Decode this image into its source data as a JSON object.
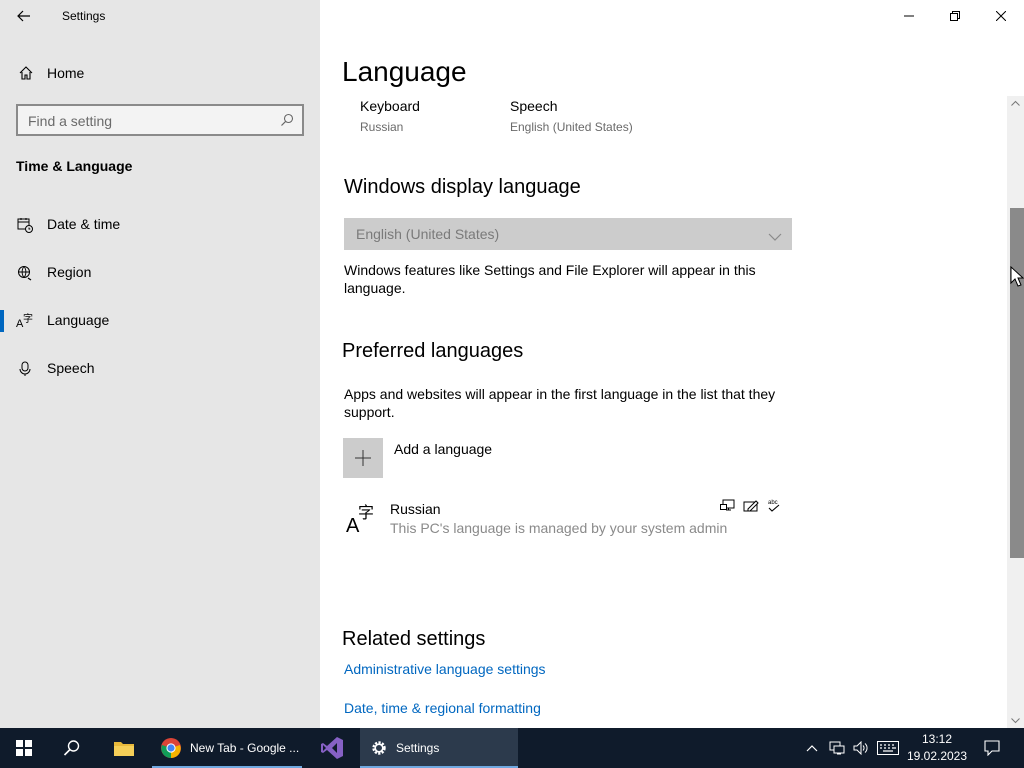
{
  "window": {
    "title": "Settings"
  },
  "sidebar": {
    "home_label": "Home",
    "search_placeholder": "Find a setting",
    "section_heading": "Time & Language",
    "items": [
      {
        "label": "Date & time",
        "icon": "date-time-icon",
        "active": false
      },
      {
        "label": "Region",
        "icon": "region-icon",
        "active": false
      },
      {
        "label": "Language",
        "icon": "language-icon",
        "active": true
      },
      {
        "label": "Speech",
        "icon": "microphone-icon",
        "active": false
      }
    ]
  },
  "main": {
    "page_title": "Language",
    "summary": {
      "keyboard_label": "Keyboard",
      "keyboard_value": "Russian",
      "speech_label": "Speech",
      "speech_value": "English (United States)"
    },
    "display_language": {
      "heading": "Windows display language",
      "selected": "English (United States)",
      "description": "Windows features like Settings and File Explorer will appear in this language."
    },
    "preferred": {
      "heading": "Preferred languages",
      "description": "Apps and websites will appear in the first language in the list that they support.",
      "add_label": "Add a language",
      "languages": [
        {
          "name": "Russian",
          "note": "This PC's language is managed by your system admin",
          "features": [
            "display-language-icon",
            "handwriting-icon",
            "spellcheck-icon"
          ]
        }
      ]
    },
    "related": {
      "heading": "Related settings",
      "links": [
        "Administrative language settings",
        "Date, time & regional formatting"
      ]
    }
  },
  "taskbar": {
    "apps": [
      {
        "label": "",
        "icon": "start-icon"
      },
      {
        "label": "",
        "icon": "search-icon"
      },
      {
        "label": "",
        "icon": "file-explorer-icon"
      },
      {
        "label": "New Tab - Google ...",
        "icon": "chrome-icon"
      },
      {
        "label": "",
        "icon": "visual-studio-icon"
      },
      {
        "label": "Settings",
        "icon": "gear-icon"
      }
    ],
    "time": "13:12",
    "date": "19.02.2023"
  },
  "colors": {
    "accent": "#0067c0",
    "sidebar_bg": "#e6e6e6",
    "taskbar_bg": "#0f1b2b"
  }
}
